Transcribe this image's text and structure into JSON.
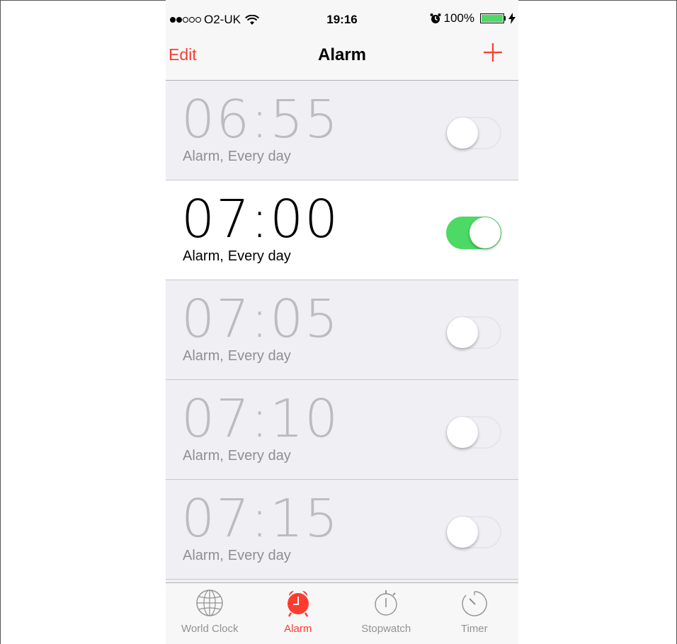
{
  "status_bar": {
    "carrier": "O2-UK",
    "time": "19:16",
    "battery_percent": "100%",
    "signal_strength": 2,
    "signal_max": 5,
    "charging": true
  },
  "nav": {
    "edit_label": "Edit",
    "title": "Alarm",
    "add_icon": "plus-icon"
  },
  "alarms": [
    {
      "time": "06:55",
      "label": "Alarm,",
      "repeat": "Every day",
      "enabled": false
    },
    {
      "time": "07:00",
      "label": "Alarm,",
      "repeat": "Every day",
      "enabled": true
    },
    {
      "time": "07:05",
      "label": "Alarm,",
      "repeat": "Every day",
      "enabled": false
    },
    {
      "time": "07:10",
      "label": "Alarm,",
      "repeat": "Every day",
      "enabled": false
    },
    {
      "time": "07:15",
      "label": "Alarm,",
      "repeat": "Every day",
      "enabled": false
    }
  ],
  "tabs": [
    {
      "label": "World Clock",
      "icon": "globe-icon",
      "active": false
    },
    {
      "label": "Alarm",
      "icon": "alarm-clock-icon",
      "active": true
    },
    {
      "label": "Stopwatch",
      "icon": "stopwatch-icon",
      "active": false
    },
    {
      "label": "Timer",
      "icon": "timer-icon",
      "active": false
    }
  ],
  "colors": {
    "accent": "#ff3b30",
    "toggle_on": "#4cd964",
    "inactive_text": "#929292"
  }
}
